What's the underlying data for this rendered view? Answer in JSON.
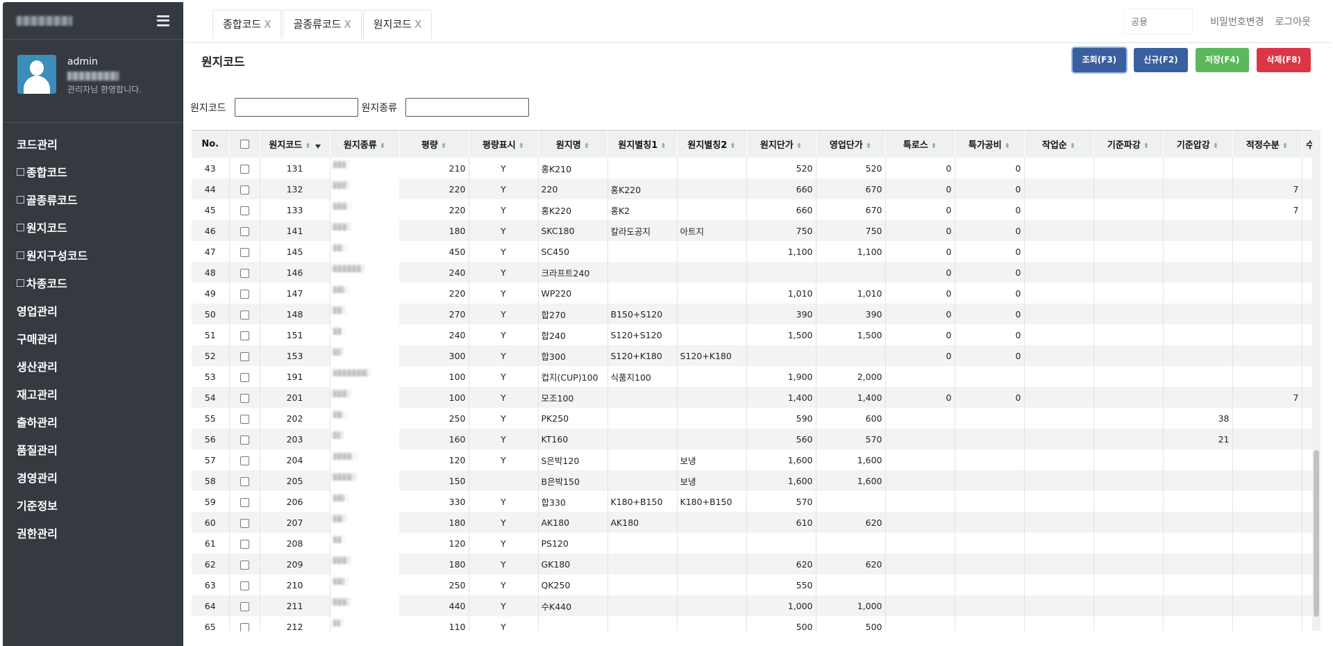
{
  "sidebar": {
    "user_name": "admin",
    "welcome": "관리자님 환영합니다.",
    "menu": [
      {
        "label": "코드관리",
        "sub": false
      },
      {
        "label": "종합코드",
        "sub": true
      },
      {
        "label": "골종류코드",
        "sub": true
      },
      {
        "label": "원지코드",
        "sub": true
      },
      {
        "label": "원지구성코드",
        "sub": true
      },
      {
        "label": "차종코드",
        "sub": true
      },
      {
        "label": "영업관리",
        "sub": false
      },
      {
        "label": "구매관리",
        "sub": false
      },
      {
        "label": "생산관리",
        "sub": false
      },
      {
        "label": "재고관리",
        "sub": false
      },
      {
        "label": "출하관리",
        "sub": false
      },
      {
        "label": "품질관리",
        "sub": false
      },
      {
        "label": "경영관리",
        "sub": false
      },
      {
        "label": "기준정보",
        "sub": false
      },
      {
        "label": "권한관리",
        "sub": false
      }
    ]
  },
  "tabs": [
    {
      "label": "종합코드",
      "close": "X"
    },
    {
      "label": "골종류코드",
      "close": "X"
    },
    {
      "label": "원지코드",
      "close": "X"
    }
  ],
  "topbar": {
    "common_placeholder": "공용",
    "change_password": "비밀번호변경",
    "logout": "로그아웃"
  },
  "page": {
    "title": "원지코드",
    "buttons": {
      "search": "조회(F3)",
      "new": "신규(F2)",
      "save": "저장(F4)",
      "delete": "삭제(F8)"
    },
    "filters": {
      "code_label": "원지코드",
      "kind_label": "원지종류"
    }
  },
  "grid": {
    "columns": [
      "No.",
      "",
      "원지코드",
      "원지종류",
      "평량",
      "평량표시",
      "원지명",
      "원지별칭1",
      "원지별칭2",
      "원지단가",
      "영업단가",
      "특로스",
      "특가공비",
      "작업순",
      "기준파강",
      "기준압강",
      "적정수분",
      "수"
    ],
    "rows": [
      {
        "no": "43",
        "code": "131",
        "bw": "210",
        "disp": "Y",
        "name": "홍K210",
        "a1": "",
        "a2": "",
        "price": "520",
        "sprice": "520",
        "loss": "0",
        "proc": "0",
        "order": "",
        "pa": "",
        "ap": "",
        "moist": ""
      },
      {
        "no": "44",
        "code": "132",
        "bw": "220",
        "disp": "Y",
        "name": "220",
        "a1": "홍K220",
        "a2": "",
        "price": "660",
        "sprice": "670",
        "loss": "0",
        "proc": "0",
        "order": "",
        "pa": "",
        "ap": "",
        "moist": "7"
      },
      {
        "no": "45",
        "code": "133",
        "bw": "220",
        "disp": "Y",
        "name": "홍K220",
        "a1": "홍K2",
        "a2": "",
        "price": "660",
        "sprice": "670",
        "loss": "0",
        "proc": "0",
        "order": "",
        "pa": "",
        "ap": "",
        "moist": "7"
      },
      {
        "no": "46",
        "code": "141",
        "bw": "180",
        "disp": "Y",
        "name": "SKC180",
        "a1": "칼라도공지",
        "a2": "아트지",
        "price": "750",
        "sprice": "750",
        "loss": "0",
        "proc": "0",
        "order": "",
        "pa": "",
        "ap": "",
        "moist": ""
      },
      {
        "no": "47",
        "code": "145",
        "bw": "450",
        "disp": "Y",
        "name": "SC450",
        "a1": "",
        "a2": "",
        "price": "1,100",
        "sprice": "1,100",
        "loss": "0",
        "proc": "0",
        "order": "",
        "pa": "",
        "ap": "",
        "moist": ""
      },
      {
        "no": "48",
        "code": "146",
        "bw": "240",
        "disp": "Y",
        "name": "크라프트240",
        "a1": "",
        "a2": "",
        "price": "",
        "sprice": "",
        "loss": "0",
        "proc": "0",
        "order": "",
        "pa": "",
        "ap": "",
        "moist": ""
      },
      {
        "no": "49",
        "code": "147",
        "bw": "220",
        "disp": "Y",
        "name": "WP220",
        "a1": "",
        "a2": "",
        "price": "1,010",
        "sprice": "1,010",
        "loss": "0",
        "proc": "0",
        "order": "",
        "pa": "",
        "ap": "",
        "moist": ""
      },
      {
        "no": "50",
        "code": "148",
        "bw": "270",
        "disp": "Y",
        "name": "합270",
        "a1": "B150+S120",
        "a2": "",
        "price": "390",
        "sprice": "390",
        "loss": "0",
        "proc": "0",
        "order": "",
        "pa": "",
        "ap": "",
        "moist": ""
      },
      {
        "no": "51",
        "code": "151",
        "bw": "240",
        "disp": "Y",
        "name": "합240",
        "a1": "S120+S120",
        "a2": "",
        "price": "1,500",
        "sprice": "1,500",
        "loss": "0",
        "proc": "0",
        "order": "",
        "pa": "",
        "ap": "",
        "moist": ""
      },
      {
        "no": "52",
        "code": "153",
        "bw": "300",
        "disp": "Y",
        "name": "합300",
        "a1": "S120+K180",
        "a2": "S120+K180",
        "price": "",
        "sprice": "",
        "loss": "0",
        "proc": "0",
        "order": "",
        "pa": "",
        "ap": "",
        "moist": ""
      },
      {
        "no": "53",
        "code": "191",
        "bw": "100",
        "disp": "Y",
        "name": "컵지(CUP)100",
        "a1": "식품지100",
        "a2": "",
        "price": "1,900",
        "sprice": "2,000",
        "loss": "",
        "proc": "",
        "order": "",
        "pa": "",
        "ap": "",
        "moist": ""
      },
      {
        "no": "54",
        "code": "201",
        "bw": "100",
        "disp": "Y",
        "name": "모조100",
        "a1": "",
        "a2": "",
        "price": "1,400",
        "sprice": "1,400",
        "loss": "0",
        "proc": "0",
        "order": "",
        "pa": "",
        "ap": "",
        "moist": "7"
      },
      {
        "no": "55",
        "code": "202",
        "bw": "250",
        "disp": "Y",
        "name": "PK250",
        "a1": "",
        "a2": "",
        "price": "590",
        "sprice": "600",
        "loss": "",
        "proc": "",
        "order": "",
        "pa": "",
        "ap": "38",
        "moist": ""
      },
      {
        "no": "56",
        "code": "203",
        "bw": "160",
        "disp": "Y",
        "name": "KT160",
        "a1": "",
        "a2": "",
        "price": "560",
        "sprice": "570",
        "loss": "",
        "proc": "",
        "order": "",
        "pa": "",
        "ap": "21",
        "moist": ""
      },
      {
        "no": "57",
        "code": "204",
        "bw": "120",
        "disp": "Y",
        "name": "S은박120",
        "a1": "",
        "a2": "보냉",
        "price": "1,600",
        "sprice": "1,600",
        "loss": "",
        "proc": "",
        "order": "",
        "pa": "",
        "ap": "",
        "moist": ""
      },
      {
        "no": "58",
        "code": "205",
        "bw": "150",
        "disp": "",
        "name": "B은박150",
        "a1": "",
        "a2": "보냉",
        "price": "1,600",
        "sprice": "1,600",
        "loss": "",
        "proc": "",
        "order": "",
        "pa": "",
        "ap": "",
        "moist": ""
      },
      {
        "no": "59",
        "code": "206",
        "bw": "330",
        "disp": "Y",
        "name": "합330",
        "a1": "K180+B150",
        "a2": "K180+B150",
        "price": "570",
        "sprice": "",
        "loss": "",
        "proc": "",
        "order": "",
        "pa": "",
        "ap": "",
        "moist": ""
      },
      {
        "no": "60",
        "code": "207",
        "bw": "180",
        "disp": "Y",
        "name": "AK180",
        "a1": "AK180",
        "a2": "",
        "price": "610",
        "sprice": "620",
        "loss": "",
        "proc": "",
        "order": "",
        "pa": "",
        "ap": "",
        "moist": ""
      },
      {
        "no": "61",
        "code": "208",
        "bw": "120",
        "disp": "Y",
        "name": "PS120",
        "a1": "",
        "a2": "",
        "price": "",
        "sprice": "",
        "loss": "",
        "proc": "",
        "order": "",
        "pa": "",
        "ap": "",
        "moist": ""
      },
      {
        "no": "62",
        "code": "209",
        "bw": "180",
        "disp": "Y",
        "name": "GK180",
        "a1": "",
        "a2": "",
        "price": "620",
        "sprice": "620",
        "loss": "",
        "proc": "",
        "order": "",
        "pa": "",
        "ap": "",
        "moist": ""
      },
      {
        "no": "63",
        "code": "210",
        "bw": "250",
        "disp": "Y",
        "name": "QK250",
        "a1": "",
        "a2": "",
        "price": "550",
        "sprice": "",
        "loss": "",
        "proc": "",
        "order": "",
        "pa": "",
        "ap": "",
        "moist": ""
      },
      {
        "no": "64",
        "code": "211",
        "bw": "440",
        "disp": "Y",
        "name": "수K440",
        "a1": "",
        "a2": "",
        "price": "1,000",
        "sprice": "1,000",
        "loss": "",
        "proc": "",
        "order": "",
        "pa": "",
        "ap": "",
        "moist": ""
      },
      {
        "no": "65",
        "code": "212",
        "bw": "110",
        "disp": "Y",
        "name": "",
        "a1": "",
        "a2": "",
        "price": "500",
        "sprice": "500",
        "loss": "",
        "proc": "",
        "order": "",
        "pa": "",
        "ap": "",
        "moist": ""
      }
    ]
  }
}
